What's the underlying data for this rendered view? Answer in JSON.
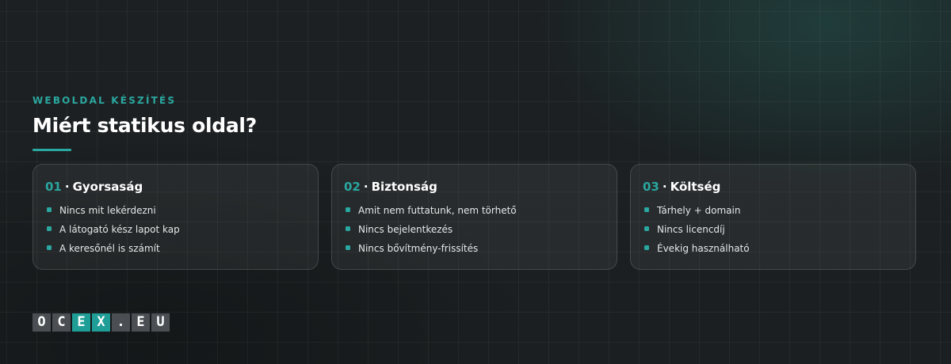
{
  "section": {
    "eyebrow": "WEBOLDAL KÉSZÍTÉS",
    "title": "Miért statikus oldal?"
  },
  "cards": [
    {
      "number": "01",
      "separator": "·",
      "title": "Gyorsaság",
      "items": [
        "Nincs mit lekérdezni",
        "A látogató kész lapot kap",
        "A keresőnél is számít"
      ]
    },
    {
      "number": "02",
      "separator": "·",
      "title": "Biztonság",
      "items": [
        "Amit nem futtatunk, nem törhető",
        "Nincs bejelentkezés",
        "Nincs bővítmény-frissítés"
      ]
    },
    {
      "number": "03",
      "separator": "·",
      "title": "Költség",
      "items": [
        "Tárhely + domain",
        "Nincs licencdíj",
        "Évekig használható"
      ]
    }
  ],
  "logo": {
    "letters": [
      "O",
      "C",
      "E",
      "X",
      ".",
      "E",
      "U"
    ]
  },
  "colors": {
    "accent": "#2aa7a0",
    "background": "#1a1d20",
    "logo_tile": "#4b4f53",
    "logo_accent_tile": "#1f9e97"
  }
}
